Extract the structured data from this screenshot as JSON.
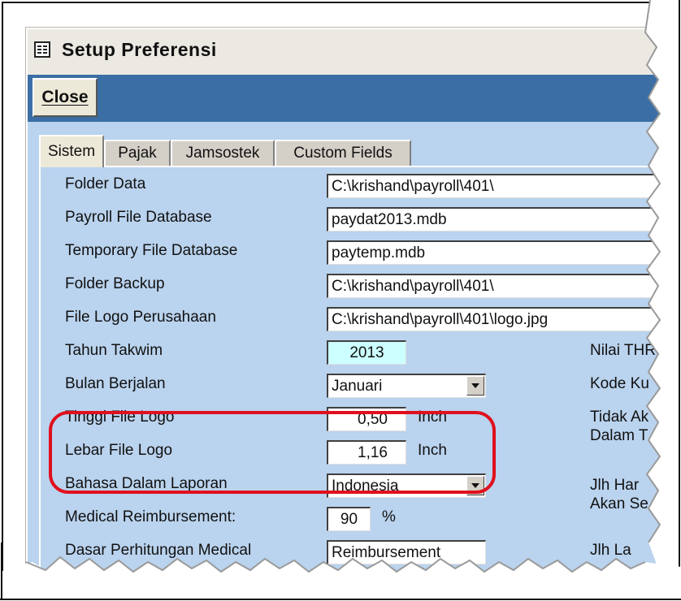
{
  "window": {
    "title": "Setup Preferensi",
    "icon": "form-icon"
  },
  "toolbar": {
    "close_label": "Close"
  },
  "tabs": [
    {
      "label": "Sistem",
      "active": true
    },
    {
      "label": "Pajak",
      "active": false
    },
    {
      "label": "Jamsostek",
      "active": false
    },
    {
      "label": "Custom Fields",
      "active": false
    }
  ],
  "form": {
    "folder_data": {
      "label": "Folder Data",
      "value": "C:\\krishand\\payroll\\401\\"
    },
    "payroll_db": {
      "label": "Payroll File Database",
      "value": "paydat2013.mdb"
    },
    "temp_db": {
      "label": "Temporary File Database",
      "value": "paytemp.mdb"
    },
    "folder_backup": {
      "label": "Folder Backup",
      "value": "C:\\krishand\\payroll\\401\\"
    },
    "logo_file": {
      "label": "File Logo Perusahaan",
      "value": "C:\\krishand\\payroll\\401\\logo.jpg"
    },
    "tahun_takwim": {
      "label": "Tahun Takwim",
      "value": "2013"
    },
    "bulan_berjalan": {
      "label": "Bulan Berjalan",
      "value": "Januari"
    },
    "tinggi_logo": {
      "label": "Tinggi File Logo",
      "value": "0,50",
      "unit": "Inch"
    },
    "lebar_logo": {
      "label": "Lebar File Logo",
      "value": "1,16",
      "unit": "Inch"
    },
    "bahasa": {
      "label": "Bahasa Dalam Laporan",
      "value": "Indonesia"
    },
    "medical": {
      "label": "Medical Reimbursement:",
      "value": "90",
      "unit": "%"
    },
    "partial_row": {
      "label": "Dasar Perhitungan Medical",
      "value": "Reimbursement"
    }
  },
  "right_column": {
    "nilai_thr": "Nilai THR",
    "kode_ku": "Kode Ku",
    "tidak_ak_1": "Tidak Ak",
    "tidak_ak_2": "Dalam T",
    "jlh_har_1": "Jlh Har",
    "jlh_har_2": "Akan Se",
    "jlh_la": "Jlh La"
  },
  "colors": {
    "toolbar": "#3a6ea5",
    "panel": "#bad3ee",
    "highlight": "#e0101e",
    "year_field": "#ccffff"
  }
}
